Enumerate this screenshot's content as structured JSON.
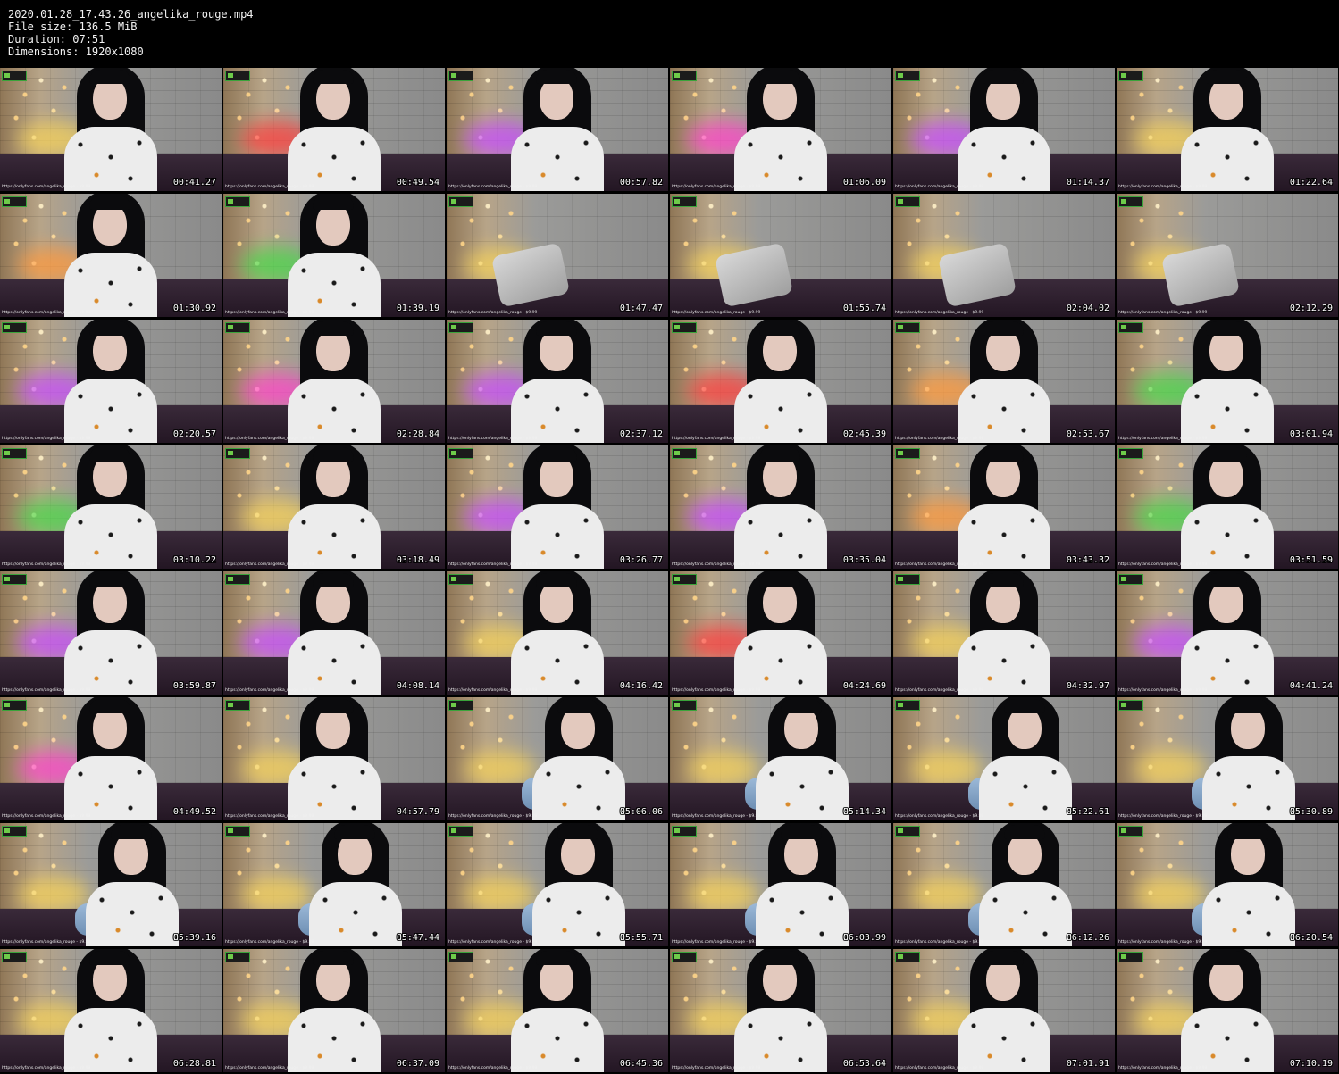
{
  "header": {
    "file_name": "2020.01.28_17.43.26_angelika_rouge.mp4",
    "file_size": "File size: 136.5 MiB",
    "duration": "Duration: 07:51",
    "dimensions": "Dimensions: 1920x1080"
  },
  "watermark": "https://onlyfans.com/angelika_rouge - $9.99",
  "thumbnails": [
    {
      "time": "00:41.27",
      "glow": "#f6d25a",
      "scene": "person"
    },
    {
      "time": "00:49.54",
      "glow": "#ff3e3e",
      "scene": "person"
    },
    {
      "time": "00:57.82",
      "glow": "#c84cff",
      "scene": "person"
    },
    {
      "time": "01:06.09",
      "glow": "#ff44cc",
      "scene": "person"
    },
    {
      "time": "01:14.37",
      "glow": "#c84cff",
      "scene": "person"
    },
    {
      "time": "01:22.64",
      "glow": "#f6d25a",
      "scene": "person"
    },
    {
      "time": "01:30.92",
      "glow": "#ff9a3e",
      "scene": "person"
    },
    {
      "time": "01:39.19",
      "glow": "#49d94a",
      "scene": "person"
    },
    {
      "time": "01:47.47",
      "glow": "#f6d25a",
      "scene": "empty"
    },
    {
      "time": "01:55.74",
      "glow": "#f6d25a",
      "scene": "empty"
    },
    {
      "time": "02:04.02",
      "glow": "#f6d25a",
      "scene": "empty"
    },
    {
      "time": "02:12.29",
      "glow": "#f6d25a",
      "scene": "empty"
    },
    {
      "time": "02:20.57",
      "glow": "#c84cff",
      "scene": "person"
    },
    {
      "time": "02:28.84",
      "glow": "#ff44cc",
      "scene": "person"
    },
    {
      "time": "02:37.12",
      "glow": "#c84cff",
      "scene": "person"
    },
    {
      "time": "02:45.39",
      "glow": "#ff3e3e",
      "scene": "person"
    },
    {
      "time": "02:53.67",
      "glow": "#ff9a3e",
      "scene": "person"
    },
    {
      "time": "03:01.94",
      "glow": "#49d94a",
      "scene": "person"
    },
    {
      "time": "03:10.22",
      "glow": "#49d94a",
      "scene": "person"
    },
    {
      "time": "03:18.49",
      "glow": "#f6d25a",
      "scene": "person"
    },
    {
      "time": "03:26.77",
      "glow": "#c84cff",
      "scene": "person"
    },
    {
      "time": "03:35.04",
      "glow": "#c84cff",
      "scene": "person"
    },
    {
      "time": "03:43.32",
      "glow": "#ff9a3e",
      "scene": "person"
    },
    {
      "time": "03:51.59",
      "glow": "#49d94a",
      "scene": "person"
    },
    {
      "time": "03:59.87",
      "glow": "#c84cff",
      "scene": "person"
    },
    {
      "time": "04:08.14",
      "glow": "#c84cff",
      "scene": "person"
    },
    {
      "time": "04:16.42",
      "glow": "#f6d25a",
      "scene": "person"
    },
    {
      "time": "04:24.69",
      "glow": "#ff3e3e",
      "scene": "person"
    },
    {
      "time": "04:32.97",
      "glow": "#f6d25a",
      "scene": "person"
    },
    {
      "time": "04:41.24",
      "glow": "#c84cff",
      "scene": "person"
    },
    {
      "time": "04:49.52",
      "glow": "#ff44cc",
      "scene": "person"
    },
    {
      "time": "04:57.79",
      "glow": "#f6d25a",
      "scene": "person"
    },
    {
      "time": "05:06.06",
      "glow": "#f6d25a",
      "scene": "kneel"
    },
    {
      "time": "05:14.34",
      "glow": "#f6d25a",
      "scene": "kneel"
    },
    {
      "time": "05:22.61",
      "glow": "#f6d25a",
      "scene": "kneel"
    },
    {
      "time": "05:30.89",
      "glow": "#f6d25a",
      "scene": "kneel"
    },
    {
      "time": "05:39.16",
      "glow": "#f6d25a",
      "scene": "kneel"
    },
    {
      "time": "05:47.44",
      "glow": "#f6d25a",
      "scene": "kneel"
    },
    {
      "time": "05:55.71",
      "glow": "#f6d25a",
      "scene": "kneel"
    },
    {
      "time": "06:03.99",
      "glow": "#f6d25a",
      "scene": "kneel"
    },
    {
      "time": "06:12.26",
      "glow": "#f6d25a",
      "scene": "kneel"
    },
    {
      "time": "06:20.54",
      "glow": "#f6d25a",
      "scene": "kneel"
    },
    {
      "time": "06:28.81",
      "glow": "#f6d25a",
      "scene": "person"
    },
    {
      "time": "06:37.09",
      "glow": "#f6d25a",
      "scene": "person"
    },
    {
      "time": "06:45.36",
      "glow": "#f6d25a",
      "scene": "person"
    },
    {
      "time": "06:53.64",
      "glow": "#f6d25a",
      "scene": "person"
    },
    {
      "time": "07:01.91",
      "glow": "#f6d25a",
      "scene": "person"
    },
    {
      "time": "07:10.19",
      "glow": "#f6d25a",
      "scene": "person"
    }
  ]
}
